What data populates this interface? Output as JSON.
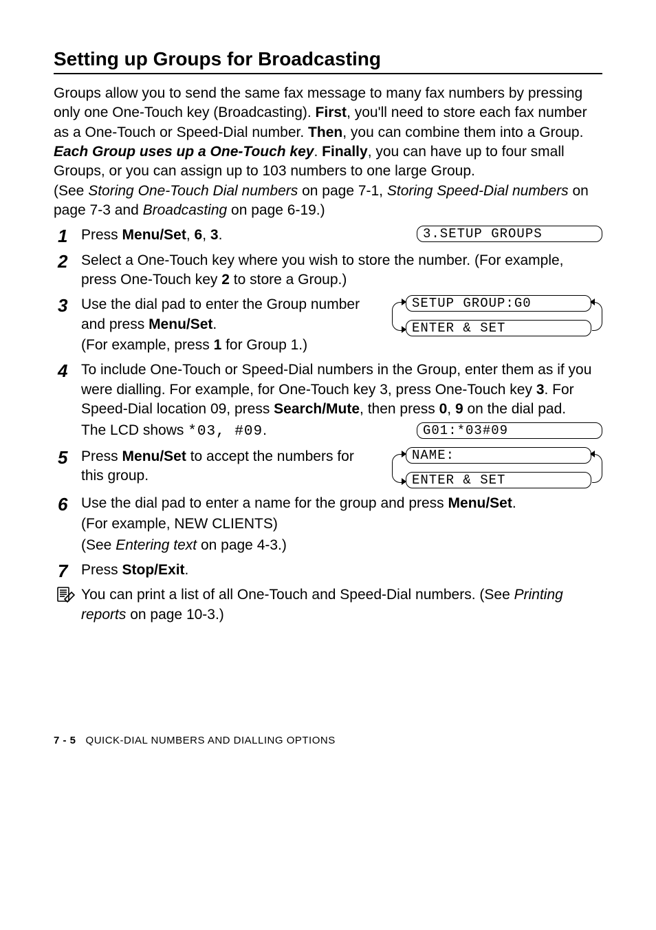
{
  "heading": "Setting up Groups for Broadcasting",
  "intro": {
    "p1a": "Groups allow you to send the same fax message to many fax numbers by pressing only one One-Touch key (Broadcasting). ",
    "first": "First",
    "p1b": ", you'll need to store each fax number as a One-Touch or Speed-Dial number. ",
    "then": "Then",
    "p1c": ", you can combine them into a Group. ",
    "each": "Each Group uses up a One-Touch key",
    "p1d": ". ",
    "finally": "Finally",
    "p1e": ", you can have up to four small Groups, or you can assign up to 103 numbers to one large Group.",
    "p2a": "(See ",
    "ref1": "Storing One-Touch Dial numbers",
    "p2b": " on page 7-1, ",
    "ref2": "Storing Speed-Dial numbers",
    "p2c": " on page 7-3 and ",
    "ref3": "Broadcasting",
    "p2d": " on page 6-19.)"
  },
  "lcds": {
    "setup_groups": "3.SETUP GROUPS",
    "setup_group_g0": "SETUP GROUP:G0",
    "enter_set_1": "ENTER & SET",
    "g01": "G01:*03#09",
    "name_field": "NAME:",
    "enter_set_2": "ENTER & SET"
  },
  "steps": {
    "s1": {
      "a": "Press ",
      "menuset": "Menu/Set",
      "b": ", ",
      "k6": "6",
      "c": ", ",
      "k3": "3",
      "d": "."
    },
    "s2": {
      "a": "Select a One-Touch key where you wish to store the number. (For example, press One-Touch key ",
      "k2": "2",
      "b": " to store a Group.)"
    },
    "s3": {
      "a": "Use the dial pad to enter the Group number and press ",
      "menuset": "Menu/Set",
      "b": ".",
      "sub": "(For example, press ",
      "k1": "1",
      "subb": " for Group 1.)"
    },
    "s4": {
      "a": "To include One-Touch or Speed-Dial numbers in the Group, enter them as if you were dialling. For example, for One-Touch key 3, press One-Touch key ",
      "k3": "3",
      "b": ". For Speed-Dial location 09, press ",
      "searchmute": "Search/Mute",
      "c": ", then press ",
      "k0": "0",
      "d": ", ",
      "k9": "9",
      "e": " on the dial pad.",
      "sub_a": "The LCD shows ",
      "sub_code": "*03, #09",
      "sub_b": "."
    },
    "s5": {
      "a": "Press ",
      "menuset": "Menu/Set",
      "b": " to accept the numbers for this group."
    },
    "s6": {
      "a": "Use the dial pad to enter a name for the group and press ",
      "menuset": "Menu/Set",
      "b": ".",
      "sub1": "(For example, NEW CLIENTS)",
      "sub2a": "(See ",
      "sub2i": "Entering text",
      "sub2b": " on page 4-3.)"
    },
    "s7": {
      "a": "Press ",
      "stopexit": "Stop/Exit",
      "b": "."
    }
  },
  "note": {
    "a": "You can print a list of all One-Touch and Speed-Dial numbers. (See ",
    "ref": "Printing reports",
    "b": " on page 10-3.)"
  },
  "footer": {
    "page": "7 - 5",
    "chapter": "QUICK-DIAL NUMBERS AND DIALLING OPTIONS"
  }
}
